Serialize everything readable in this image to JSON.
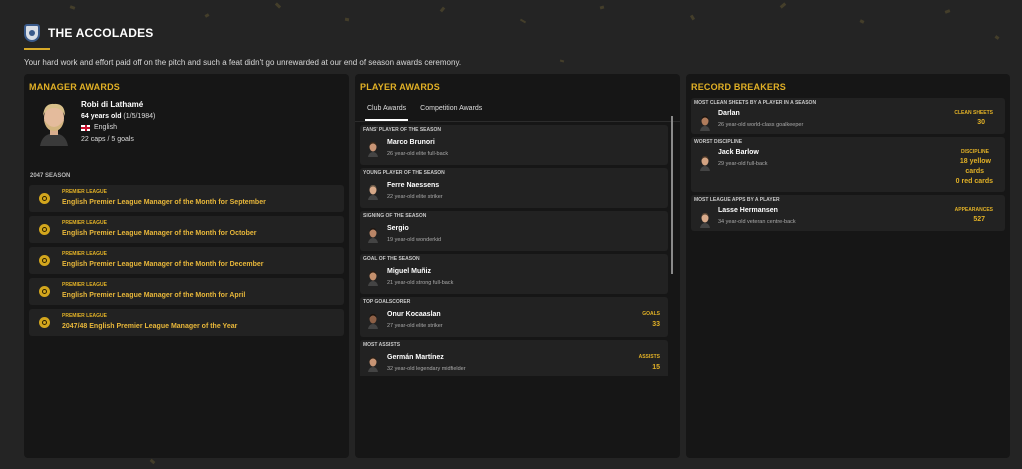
{
  "header": {
    "title": "THE ACCOLADES",
    "subtitle": "Your hard work and effort paid off on the pitch and such a feat didn't go unrewarded at our end of season awards ceremony."
  },
  "manager_awards": {
    "title": "MANAGER AWARDS",
    "profile": {
      "name": "Robi di Lathamé",
      "age": "64 years old",
      "dob": "(1/5/1984)",
      "nationality": "English",
      "caps_goals": "22 caps / 5 goals"
    },
    "season_label": "2047 SEASON",
    "awards": [
      {
        "competition": "PREMIER LEAGUE",
        "name": "English Premier League Manager of the Month for September"
      },
      {
        "competition": "PREMIER LEAGUE",
        "name": "English Premier League Manager of the Month for October"
      },
      {
        "competition": "PREMIER LEAGUE",
        "name": "English Premier League Manager of the Month for December"
      },
      {
        "competition": "PREMIER LEAGUE",
        "name": "English Premier League Manager of the Month for April"
      },
      {
        "competition": "PREMIER LEAGUE",
        "name": "2047/48 English Premier League Manager of the Year"
      }
    ]
  },
  "player_awards": {
    "title": "PLAYER AWARDS",
    "tabs": [
      {
        "label": "Club Awards",
        "active": true
      },
      {
        "label": "Competition Awards",
        "active": false
      }
    ],
    "items": [
      {
        "category": "FANS' PLAYER OF THE SEASON",
        "name": "Marco Brunori",
        "desc": "26 year-old elite full-back",
        "stat_label": "",
        "stat_value": ""
      },
      {
        "category": "YOUNG PLAYER OF THE SEASON",
        "name": "Ferre Naessens",
        "desc": "22 year-old elite striker",
        "stat_label": "",
        "stat_value": ""
      },
      {
        "category": "SIGNING OF THE SEASON",
        "name": "Sergio",
        "desc": "19 year-old wonderkid",
        "stat_label": "",
        "stat_value": ""
      },
      {
        "category": "GOAL OF THE SEASON",
        "name": "Miguel Muñiz",
        "desc": "21 year-old strong full-back",
        "stat_label": "",
        "stat_value": ""
      },
      {
        "category": "TOP GOALSCORER",
        "name": "Onur Kocaaslan",
        "desc": "27 year-old elite striker",
        "stat_label": "GOALS",
        "stat_value": "33"
      },
      {
        "category": "MOST ASSISTS",
        "name": "Germán Martínez",
        "desc": "32 year-old legendary midfielder",
        "stat_label": "ASSISTS",
        "stat_value": "15"
      }
    ]
  },
  "record_breakers": {
    "title": "RECORD BREAKERS",
    "items": [
      {
        "category": "MOST CLEAN SHEETS BY A PLAYER IN A SEASON",
        "name": "Darlan",
        "desc": "26 year-old world-class goalkeeper",
        "stat_label": "CLEAN SHEETS",
        "stat_lines": [
          "30"
        ]
      },
      {
        "category": "WORST DISCIPLINE",
        "name": "Jack Barlow",
        "desc": "29 year-old full-back",
        "stat_label": "DISCIPLINE",
        "stat_lines": [
          "18 yellow",
          "cards",
          "0 red cards"
        ]
      },
      {
        "category": "MOST LEAGUE APPS BY A PLAYER",
        "name": "Lasse Hermansen",
        "desc": "34 year-old veteran centre-back",
        "stat_label": "APPEARANCES",
        "stat_lines": [
          "527"
        ]
      }
    ]
  },
  "colors": {
    "accent": "#e2b126",
    "panel_bg": "#161616",
    "card_bg": "#222222",
    "page_bg": "#242424"
  }
}
